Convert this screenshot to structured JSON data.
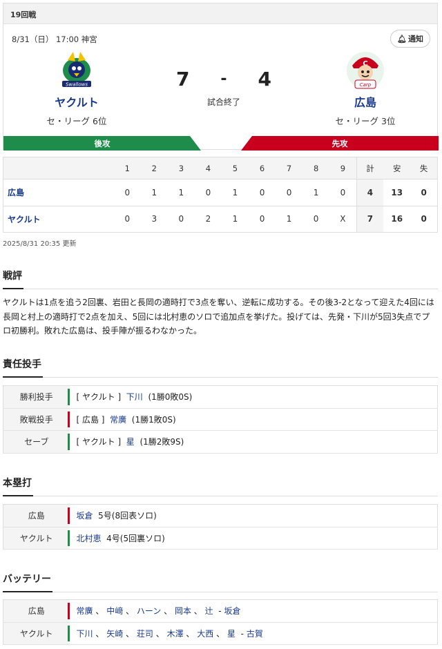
{
  "game": {
    "round": "19回戦",
    "datetime": "8/31（日） 17:00 神宮",
    "notify_label": "通知",
    "status": "試合終了",
    "home": {
      "name": "ヤクルト",
      "rank": "セ・リーグ 6位",
      "score": "7",
      "bat_order": "後攻",
      "color": "#1e8c4a"
    },
    "away": {
      "name": "広島",
      "rank": "セ・リーグ 3位",
      "score": "4",
      "bat_order": "先攻",
      "color": "#c8001d"
    },
    "score_sep": "-"
  },
  "scoreboard": {
    "headers": [
      "1",
      "2",
      "3",
      "4",
      "5",
      "6",
      "7",
      "8",
      "9",
      "計",
      "安",
      "失"
    ],
    "rows": [
      {
        "team": "広島",
        "innings": [
          "0",
          "1",
          "1",
          "0",
          "1",
          "0",
          "0",
          "1",
          "0"
        ],
        "runs": "4",
        "hits": "13",
        "errors": "0"
      },
      {
        "team": "ヤクルト",
        "innings": [
          "0",
          "3",
          "0",
          "2",
          "1",
          "0",
          "1",
          "0",
          "X"
        ],
        "runs": "7",
        "hits": "16",
        "errors": "0"
      }
    ],
    "updated": "2025/8/31 20:35 更新"
  },
  "review": {
    "title": "戦評",
    "text": "ヤクルトは1点を追う2回裏、岩田と長岡の適時打で3点を奪い、逆転に成功する。その後3-2となって迎えた4回には長岡と村上の適時打で2点を加え、5回には北村恵のソロで追加点を挙げた。投げては、先発・下川が5回3失点でプロ初勝利。敗れた広島は、投手陣が振るわなかった。"
  },
  "pitchers": {
    "title": "責任投手",
    "rows": [
      {
        "label": "勝利投手",
        "team": "[ ヤクルト ]",
        "player": "下川",
        "record": "(1勝0敗0S)",
        "color": "green"
      },
      {
        "label": "敗戦投手",
        "team": "[ 広島 ]",
        "player": "常廣",
        "record": "(1勝1敗0S)",
        "color": "red"
      },
      {
        "label": "セーブ",
        "team": "[ ヤクルト ]",
        "player": "星",
        "record": "(1勝2敗9S)",
        "color": "green"
      }
    ]
  },
  "homeruns": {
    "title": "本塁打",
    "rows": [
      {
        "label": "広島",
        "player": "坂倉",
        "detail": "5号(8回表ソロ)",
        "color": "red"
      },
      {
        "label": "ヤクルト",
        "player": "北村恵",
        "detail": "4号(5回裏ソロ)",
        "color": "green"
      }
    ]
  },
  "battery": {
    "title": "バッテリー",
    "rows": [
      {
        "label": "広島",
        "pitchers": [
          "常廣",
          "中﨑",
          "ハーン",
          "岡本",
          "辻"
        ],
        "catcher": "坂倉",
        "color": "red"
      },
      {
        "label": "ヤクルト",
        "pitchers": [
          "下川",
          "矢崎",
          "荘司",
          "木澤",
          "大西",
          "星"
        ],
        "catcher": "古賀",
        "color": "green"
      }
    ],
    "separator": "、",
    "catcher_prefix": "- "
  }
}
